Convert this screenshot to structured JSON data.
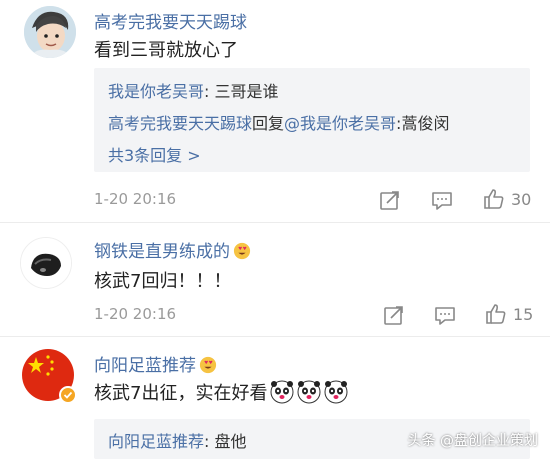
{
  "comments": [
    {
      "username": "高考完我要天天踢球",
      "content": "看到三哥就放心了",
      "replies": [
        {
          "who": "我是你老吴哥",
          "text": ": 三哥是谁"
        },
        {
          "who": "高考完我要天天踢球",
          "mid": "回复",
          "target": "@我是你老吴哥",
          "text": ":蒿俊闵"
        }
      ],
      "more": "共3条回复 >",
      "time": "1-20 20:16",
      "likes": "30"
    },
    {
      "username": "钢铁是直男练成的",
      "content": "核武7回归！！！",
      "time": "1-20 20:16",
      "likes": "15"
    },
    {
      "username": "向阳足蓝推荐",
      "content": "核武7出征，实在好看",
      "replies": [
        {
          "who": "向阳足蓝推荐",
          "text": ": 盘他"
        }
      ]
    }
  ],
  "watermark": "头条 @盘创企业策划",
  "icons": {
    "share": "share-icon",
    "comment": "comment-icon",
    "like": "thumbs-up-icon",
    "emoji_badge": "heart-eyes-emoji-icon",
    "panda": "panda-emoji-icon",
    "verified": "verified-badge-icon"
  }
}
